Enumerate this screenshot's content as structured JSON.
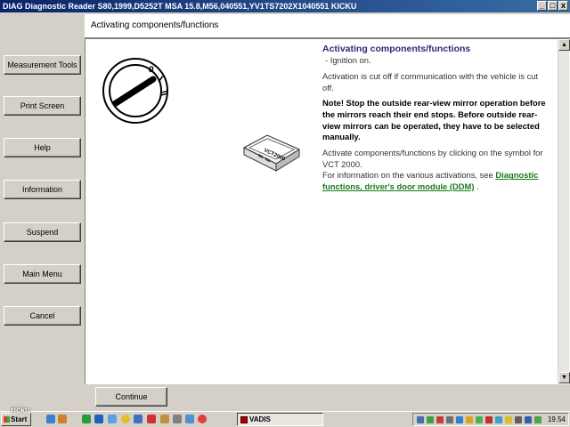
{
  "window": {
    "title": "DIAG Diagnostic Reader S80,1999,D5252T MSA 15.8,M56,040551,YV1TS7202X1040551 KICKU",
    "min_symbol": "_",
    "max_symbol": "□",
    "close_symbol": "x"
  },
  "sidebar": {
    "items": [
      {
        "label": "Measurement Tools"
      },
      {
        "label": "Print Screen"
      },
      {
        "label": "Help"
      },
      {
        "label": "Information"
      },
      {
        "label": "Suspend"
      },
      {
        "label": "Main Menu"
      },
      {
        "label": "Cancel"
      }
    ]
  },
  "header": {
    "title": "Activating components/functions"
  },
  "main": {
    "heading": "Activating components/functions",
    "bullet": "-  Ignition on.",
    "para1": "Activation is cut off if communication with the vehicle is cut off.",
    "note_bold": "Note! Stop the outside rear-view mirror operation before the mirrors reach their end stops. Before outside rear-view mirrors can be operated, they have to be selected manually.",
    "para2": "Activate components/functions by clicking on the symbol for VCT 2000.",
    "para3_prefix": "For information on the various activations, see",
    "link": "Diagnostic functions, driver's door module (DDM)",
    "para3_suffix": " .",
    "ignition_marks": [
      "0",
      "I",
      "II"
    ],
    "vct_label": "VCT2000"
  },
  "footer": {
    "continue_label": "Continue"
  },
  "taskbar": {
    "start_label": "Start",
    "task_label": "VADIS",
    "clock": "19.54"
  },
  "watermark": "ricku",
  "colors": {
    "titlebar": "#0a246a",
    "heading": "#2b2b7a",
    "link": "#1a7a1a",
    "face": "#d4d0c8"
  }
}
